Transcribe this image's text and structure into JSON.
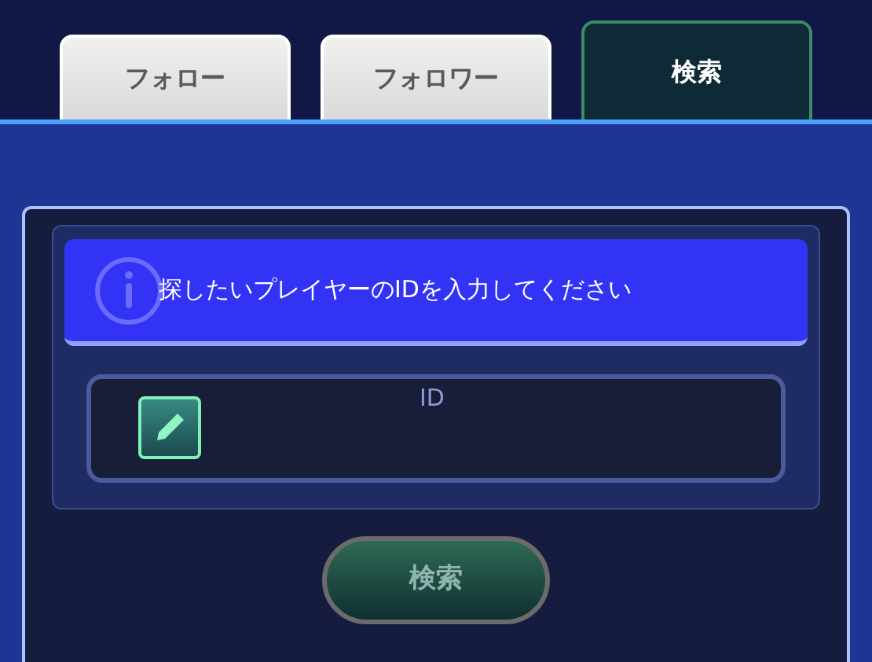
{
  "tabs": [
    {
      "label": "フォロー",
      "selected": false
    },
    {
      "label": "フォロワー",
      "selected": false
    },
    {
      "label": "検索",
      "selected": true
    }
  ],
  "message": "探したいプレイヤーのIDを入力してください",
  "id_field": {
    "label": "ID"
  },
  "search_button": {
    "label": "検索",
    "disabled": true
  }
}
